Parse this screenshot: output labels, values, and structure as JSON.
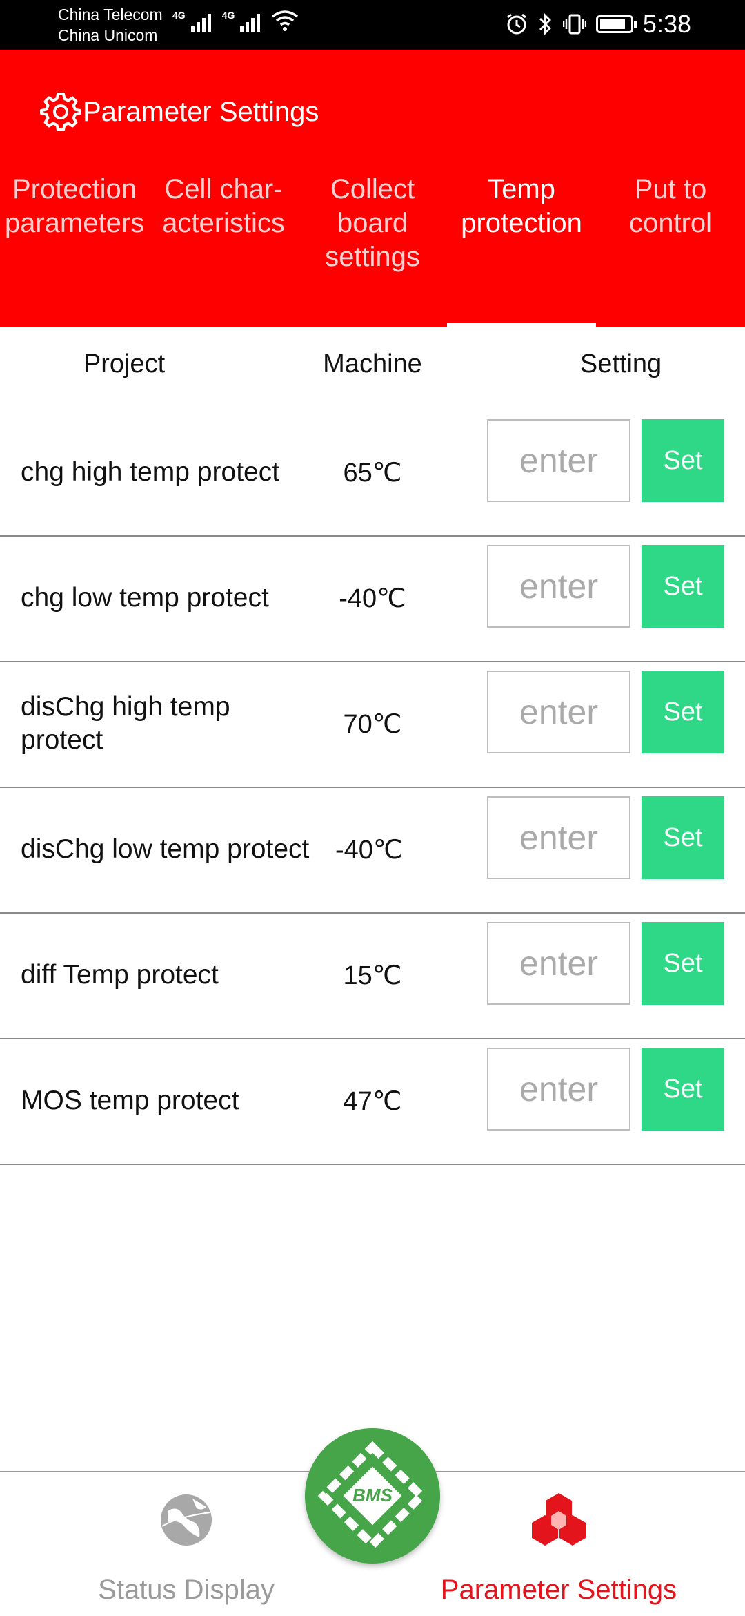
{
  "status_bar": {
    "carrier_1": "China Telecom",
    "carrier_2": "China Unicom",
    "network_1": "4G",
    "network_2": "4G",
    "time": "5:38"
  },
  "header": {
    "title": "Parameter Settings",
    "icon": "gear-icon",
    "background_color": "#ff0000"
  },
  "tabs": [
    {
      "label": "Protection parameters",
      "active": false
    },
    {
      "label": "Cell char-acteristics",
      "active": false
    },
    {
      "label": "Collect board settings",
      "active": false
    },
    {
      "label": "Temp protection",
      "active": true
    },
    {
      "label": "Put to control",
      "active": false
    }
  ],
  "table": {
    "headers": {
      "project": "Project",
      "machine": "Machine",
      "setting": "Setting"
    },
    "input_placeholder": "enter",
    "set_label": "Set",
    "rows": [
      {
        "project": "chg high temp protect",
        "machine": "65℃"
      },
      {
        "project": "chg low temp protect",
        "machine": "-40℃"
      },
      {
        "project": "disChg high temp protect",
        "machine": "70℃"
      },
      {
        "project": "disChg low temp protect",
        "machine": "-40℃"
      },
      {
        "project": "diff Temp protect",
        "machine": "15℃"
      },
      {
        "project": "MOS temp protect",
        "machine": "47℃"
      }
    ]
  },
  "bottom_nav": {
    "status_label": "Status Display",
    "params_label": "Parameter Settings",
    "center_logo": "BMS",
    "active": "params",
    "active_color": "#e3141c",
    "set_button_color": "#2fd886"
  }
}
